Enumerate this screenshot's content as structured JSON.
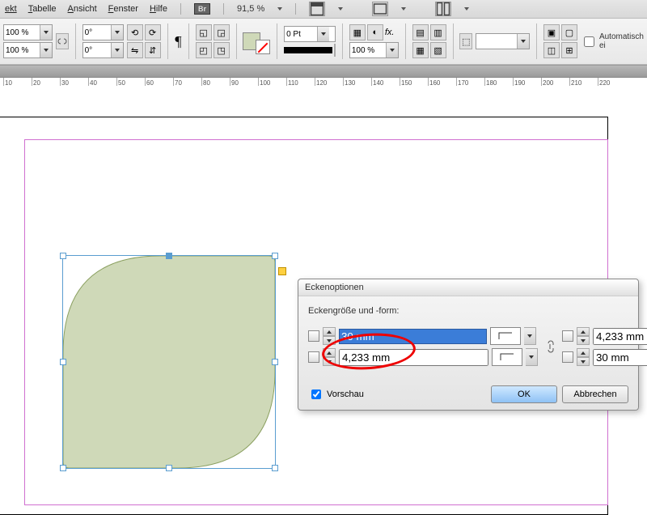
{
  "menu": {
    "ekt": "ekt",
    "tabelle": "Tabelle",
    "ansicht": "Ansicht",
    "fenster": "Fenster",
    "hilfe": "Hilfe",
    "br": "Br",
    "zoom": "91,5 %"
  },
  "panel": {
    "pct": "100 %",
    "deg": "0°",
    "pt": "0 Pt",
    "auto": "Automatisch ei"
  },
  "ruler": {
    "marks": [
      10,
      20,
      30,
      40,
      50,
      60,
      70,
      80,
      90,
      100,
      110,
      120,
      130,
      140,
      150,
      160,
      170,
      180,
      190,
      200,
      210,
      220
    ]
  },
  "dialog": {
    "title": "Eckenoptionen",
    "header": "Eckengröße und -form:",
    "tl": "30 mm",
    "tr": "4,233 mm",
    "bl": "4,233 mm",
    "br": "30 mm",
    "preview": "Vorschau",
    "ok": "OK",
    "cancel": "Abbrechen"
  }
}
